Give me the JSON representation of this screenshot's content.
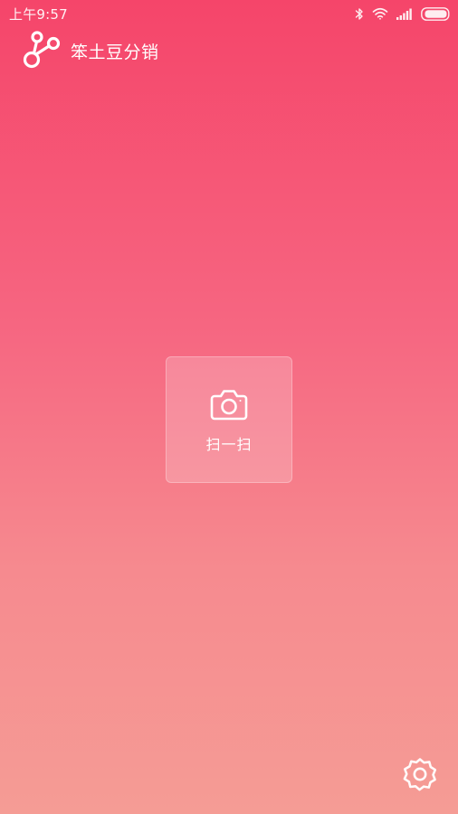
{
  "status_bar": {
    "time": "上午9:57",
    "icons": [
      "bluetooth-icon",
      "wifi-icon",
      "signal-icon",
      "battery-icon"
    ]
  },
  "header": {
    "app_title": "笨土豆分销",
    "logo_icon": "molecule-logo-icon"
  },
  "main": {
    "scan_button": {
      "label": "扫一扫",
      "icon": "camera-icon"
    }
  },
  "footer": {
    "settings_icon": "gear-icon"
  },
  "colors": {
    "gradient_top": "#f5456a",
    "gradient_bottom": "#f59c95",
    "foreground": "#ffffff"
  }
}
